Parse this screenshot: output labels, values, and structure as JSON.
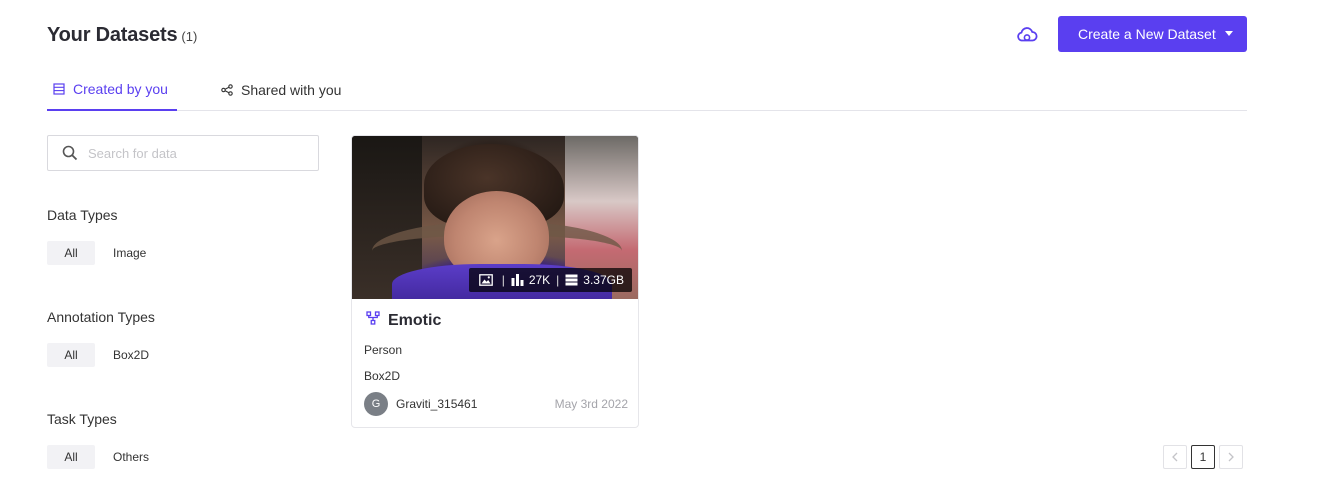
{
  "header": {
    "title": "Your Datasets",
    "count": "(1)",
    "create_label": "Create a New Dataset",
    "accent": "#5a3ff0"
  },
  "tabs": [
    {
      "label": "Created by you",
      "icon": "list-icon",
      "active": true
    },
    {
      "label": "Shared with you",
      "icon": "share-icon",
      "active": false
    }
  ],
  "search": {
    "placeholder": "Search for data",
    "value": ""
  },
  "filters": {
    "data_types": {
      "title": "Data Types",
      "options": [
        "All",
        "Image"
      ],
      "selected": "All"
    },
    "annotation_types": {
      "title": "Annotation Types",
      "options": [
        "All",
        "Box2D"
      ],
      "selected": "All"
    },
    "task_types": {
      "title": "Task Types",
      "options": [
        "All",
        "Others"
      ],
      "selected": "All"
    }
  },
  "datasets": [
    {
      "name": "Emotic",
      "count": "27K",
      "size": "3.37GB",
      "category": "Person",
      "annotation": "Box2D",
      "owner_initial": "G",
      "owner": "Graviti_315461",
      "date": "May 3rd 2022"
    }
  ],
  "pagination": {
    "current": "1"
  }
}
